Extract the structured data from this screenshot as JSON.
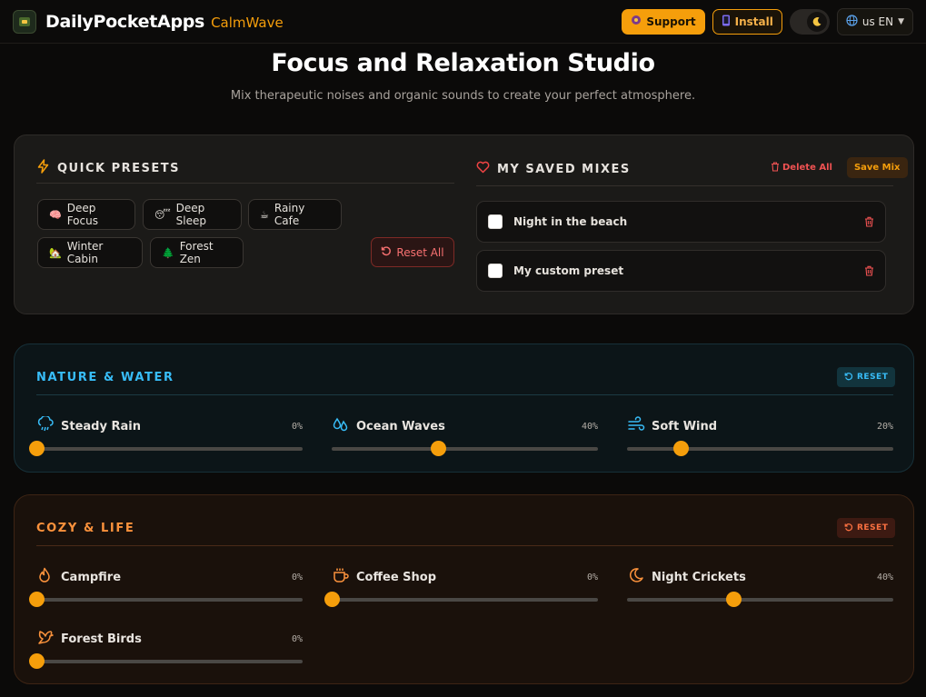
{
  "header": {
    "brand": "DailyPocketApps",
    "app": "CalmWave",
    "support_label": "Support",
    "install_label": "Install",
    "lang_label": "us EN"
  },
  "hero": {
    "title": "Focus and Relaxation Studio",
    "subtitle": "Mix therapeutic noises and organic sounds to create your perfect atmosphere."
  },
  "presets": {
    "title": "QUICK PRESETS",
    "items": [
      {
        "label": "Deep Focus",
        "emoji": "🧠"
      },
      {
        "label": "Deep Sleep",
        "emoji": "😴"
      },
      {
        "label": "Rainy Cafe",
        "emoji": "☕"
      },
      {
        "label": "Winter Cabin",
        "emoji": "🏡"
      },
      {
        "label": "Forest Zen",
        "emoji": "🌲"
      }
    ],
    "reset_all_label": "Reset All"
  },
  "saved": {
    "title": "MY SAVED MIXES",
    "delete_all_label": "Delete All",
    "save_mix_label": "Save Mix",
    "mixes": [
      {
        "name": "Night in the beach",
        "checked": false
      },
      {
        "name": "My custom preset",
        "checked": false
      }
    ]
  },
  "categories": {
    "nature": {
      "title": "NATURE & WATER",
      "accent": "#38bdf8",
      "reset_label": "RESET",
      "sounds": [
        {
          "name": "Steady Rain",
          "percent_label": "0%",
          "level": 0,
          "icon": "cloud-rain-icon"
        },
        {
          "name": "Ocean Waves",
          "percent_label": "40%",
          "level": 40,
          "icon": "droplets-icon"
        },
        {
          "name": "Soft Wind",
          "percent_label": "20%",
          "level": 20,
          "icon": "wind-icon"
        }
      ]
    },
    "cozy": {
      "title": "COZY & LIFE",
      "accent": "#fb923c",
      "reset_label": "RESET",
      "sounds": [
        {
          "name": "Campfire",
          "percent_label": "0%",
          "level": 0,
          "icon": "flame-icon"
        },
        {
          "name": "Coffee Shop",
          "percent_label": "0%",
          "level": 0,
          "icon": "coffee-icon"
        },
        {
          "name": "Night Crickets",
          "percent_label": "40%",
          "level": 40,
          "icon": "moon-icon"
        },
        {
          "name": "Forest Birds",
          "percent_label": "0%",
          "level": 0,
          "icon": "bird-icon"
        }
      ]
    }
  },
  "colors": {
    "accent": "#f59e0b",
    "danger": "#f05252"
  }
}
